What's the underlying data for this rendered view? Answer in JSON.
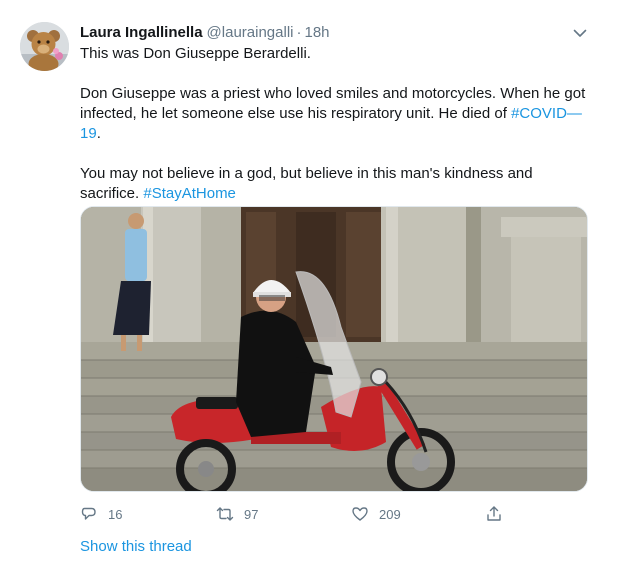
{
  "author": {
    "display_name": "Laura Ingallinella",
    "handle": "@lauraingalli",
    "separator": "·",
    "time": "18h",
    "avatar_icon": "teddy-bear-avatar"
  },
  "tweet": {
    "line1": "This was Don Giuseppe Berardelli.",
    "para2_text": "Don Giuseppe was a priest who loved smiles and motorcycles. When he got infected, he let someone else use his respiratory unit. He died of ",
    "para2_hashtag": "#COVID—19",
    "para2_end": ".",
    "para3_text": "You may not believe in a god, but believe in this man's kindness and sacrifice. ",
    "para3_hashtag": "#StayAtHome"
  },
  "media": {
    "description_icon": "photo-priest-on-red-scooter"
  },
  "actions": {
    "reply_count": "16",
    "retweet_count": "97",
    "like_count": "209"
  },
  "show_thread": "Show this thread",
  "colors": {
    "link": "#1b95e0",
    "secondary": "#657786",
    "primary_text": "#14171a"
  }
}
